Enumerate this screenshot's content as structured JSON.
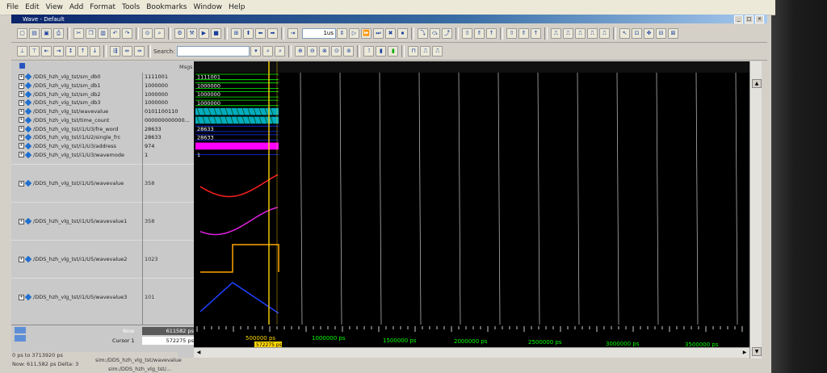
{
  "menu": [
    "File",
    "Edit",
    "View",
    "Add",
    "Format",
    "Tools",
    "Bookmarks",
    "Window",
    "Help"
  ],
  "window_title": "Wave - Default",
  "toolbar": {
    "time_value": "1us",
    "search_label": "Search:"
  },
  "pane_header": {
    "msgs": "Msgs"
  },
  "signals": [
    {
      "name": "/DDS_hzh_vlg_tst/sm_db0",
      "value": "1111001",
      "wave_text": "1111001"
    },
    {
      "name": "/DDS_hzh_vlg_tst/sm_db1",
      "value": "1000000",
      "wave_text": "1000000"
    },
    {
      "name": "/DDS_hzh_vlg_tst/sm_db2",
      "value": "1000000",
      "wave_text": "1000000"
    },
    {
      "name": "/DDS_hzh_vlg_tst/sm_db3",
      "value": "1000000",
      "wave_text": "1000000"
    },
    {
      "name": "/DDS_hzh_vlg_tst/wavevalue",
      "value": "0101100110",
      "wave_text": ""
    },
    {
      "name": "/DDS_hzh_vlg_tst/time_count",
      "value": "000000000000...",
      "wave_text": ""
    },
    {
      "name": "/DDS_hzh_vlg_tst/i1/U3/fre_word",
      "value": "28633",
      "wave_text": "28633"
    },
    {
      "name": "/DDS_hzh_vlg_tst/i1/U2/single_frc",
      "value": "28633",
      "wave_text": "28633"
    },
    {
      "name": "/DDS_hzh_vlg_tst/i1/U3/address",
      "value": "974",
      "wave_text": ""
    },
    {
      "name": "/DDS_hzh_vlg_tst/i1/U3/wavemode",
      "value": "1",
      "wave_text": "1"
    }
  ],
  "analog_signals": [
    {
      "name": "/DDS_hzh_vlg_tst/i1/U5/wavevalue",
      "value": "358",
      "color": "#ff2020",
      "shape": "sine"
    },
    {
      "name": "/DDS_hzh_vlg_tst/i1/U5/wavevalue1",
      "value": "358",
      "color": "#e020e0",
      "shape": "sine"
    },
    {
      "name": "/DDS_hzh_vlg_tst/i1/U5/wavevalue2",
      "value": "1023",
      "color": "#ffa500",
      "shape": "square"
    },
    {
      "name": "/DDS_hzh_vlg_tst/i1/U5/wavevalue3",
      "value": "101",
      "color": "#2040ff",
      "shape": "triangle"
    }
  ],
  "colors": {
    "wave_green": "#00ff00",
    "cursor_yellow": "#ffd700",
    "bus_cyan": "#00e5ff",
    "address_magenta": "#ff00ff",
    "timeline_text": "#00ff00"
  },
  "now": {
    "label": "Now",
    "value": "611582 ps"
  },
  "cursor": {
    "label": "Cursor 1",
    "value": "572275 ps",
    "marker": "572275 ps",
    "near_label": "500000 ps"
  },
  "timeline_ticks": [
    "1000000 ps",
    "1500000 ps",
    "2000000 ps",
    "2500000 ps",
    "3000000 ps",
    "3500000 ps"
  ],
  "status": {
    "range": "0 ps to 3713920 ps",
    "now_delta": "Now: 611,582 ps  Delta: 3",
    "tab1": "sim:/DDS_hzh_vlg_tst/wavevalue",
    "tab2": "sim:/DDS_hzh_vlg_tst/..."
  }
}
